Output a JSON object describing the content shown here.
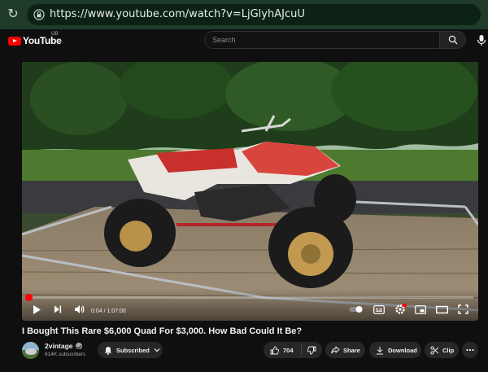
{
  "browser": {
    "url": "https://www.youtube.com/watch?v=LjGlyhAJcuU"
  },
  "header": {
    "logo_text": "YouTube",
    "region": "GB",
    "search_placeholder": "Search"
  },
  "player": {
    "time_display": "0:04 / 1:07:00",
    "progress_fraction": 0.001,
    "colors": {
      "progress": "#ff0000",
      "settings_badge": "#ff0000"
    }
  },
  "video": {
    "title": "I Bought This Rare $6,000 Quad For $3,000. How Bad Could It Be?",
    "channel_name": "2vintage",
    "subscribers": "614K subscribers",
    "subscribe_label": "Subscribed",
    "likes": "704",
    "share_label": "Share",
    "download_label": "Download",
    "clip_label": "Clip"
  },
  "icons": [
    "reload-icon",
    "lock-icon",
    "search-icon",
    "mic-icon",
    "play-icon",
    "next-icon",
    "volume-icon",
    "autoplay-toggle",
    "captions-icon",
    "settings-icon",
    "miniplayer-icon",
    "theater-icon",
    "fullscreen-icon",
    "bell-icon",
    "like-icon",
    "dislike-icon",
    "share-icon",
    "download-icon",
    "clip-icon",
    "more-icon"
  ]
}
